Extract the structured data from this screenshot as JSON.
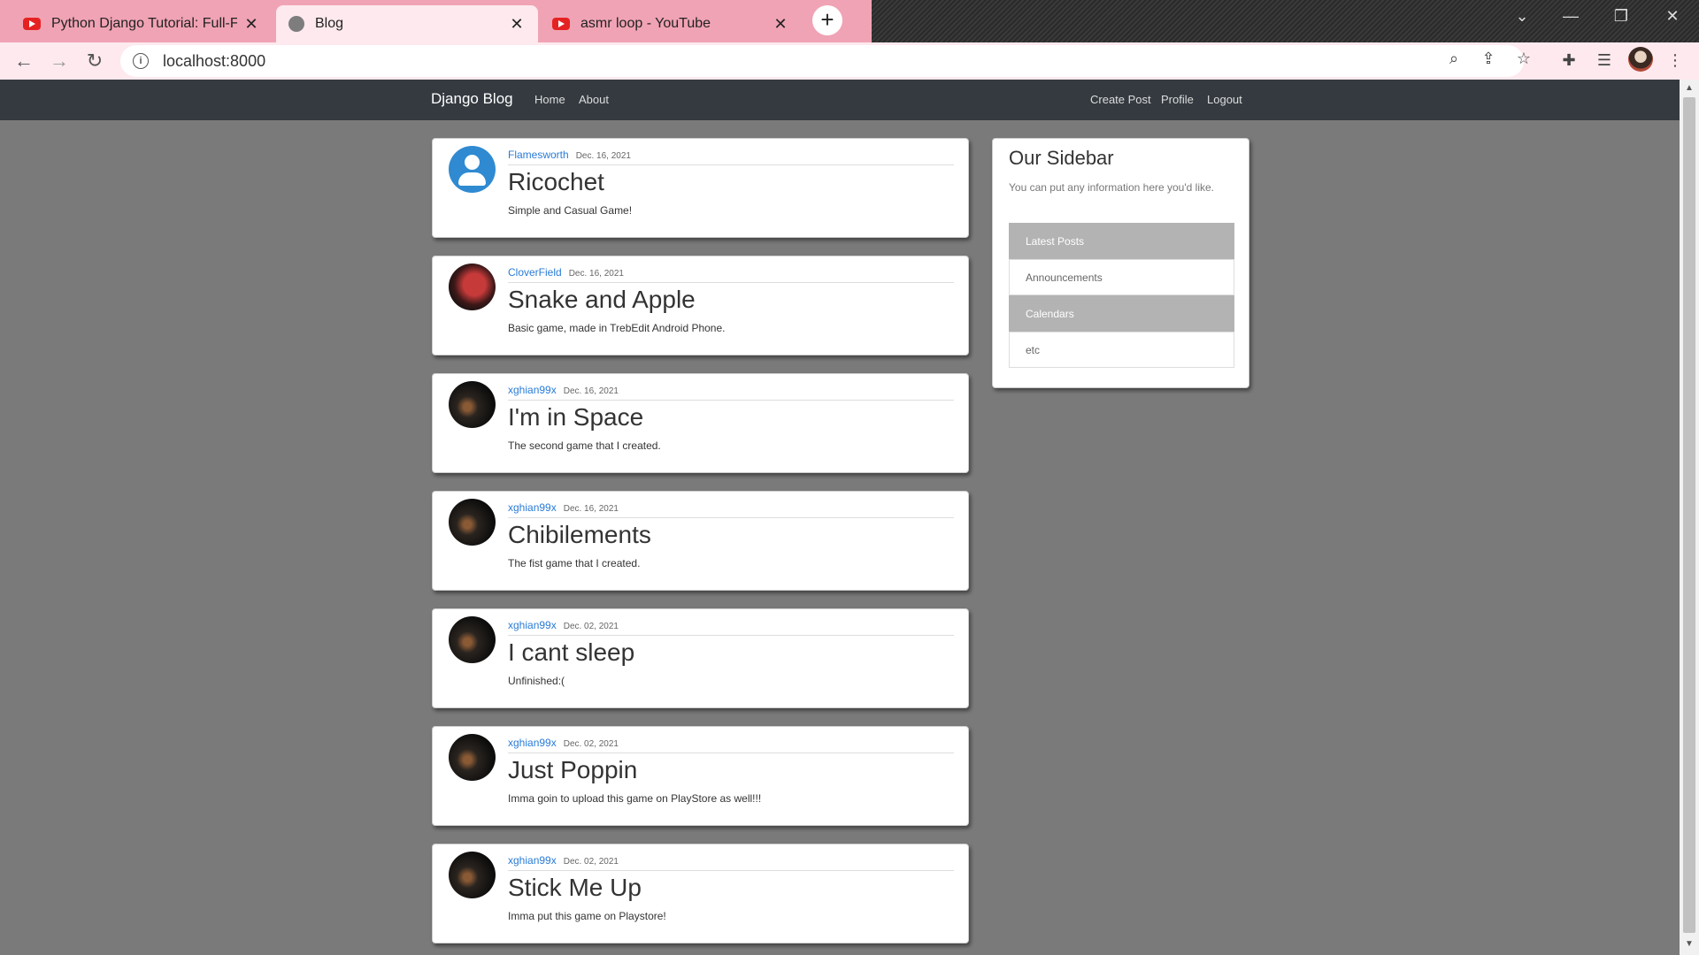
{
  "browser": {
    "tabs": [
      {
        "label": "Python Django Tutorial: Full-Feat",
        "favicon": "youtube-icon"
      },
      {
        "label": "Blog",
        "favicon": "globe-icon"
      },
      {
        "label": "asmr loop - YouTube",
        "favicon": "youtube-icon"
      }
    ],
    "active_tab_index": 1,
    "url": "localhost:8000",
    "colors": {
      "tabbar": "#f0a3b4",
      "toolbar": "#fde9ee"
    }
  },
  "site": {
    "brand": "Django Blog",
    "nav_left": [
      "Home",
      "About"
    ],
    "nav_right": [
      "Create Post",
      "Profile",
      "Logout"
    ]
  },
  "posts": [
    {
      "author": "Flamesworth",
      "date": "Dec. 16, 2021",
      "title": "Ricochet",
      "content": "Simple and Casual Game!",
      "avatar": "default-user-avatar"
    },
    {
      "author": "CloverField",
      "date": "Dec. 16, 2021",
      "title": "Snake and Apple",
      "content": "Basic game, made in TrebEdit Android Phone.",
      "avatar": "spiderman-avatar"
    },
    {
      "author": "xghian99x",
      "date": "Dec. 16, 2021",
      "title": "I'm in Space",
      "content": "The second game that I created.",
      "avatar": "dark-avatar"
    },
    {
      "author": "xghian99x",
      "date": "Dec. 16, 2021",
      "title": "Chibilements",
      "content": "The fist game that I created.",
      "avatar": "dark-avatar"
    },
    {
      "author": "xghian99x",
      "date": "Dec. 02, 2021",
      "title": "I cant sleep",
      "content": "Unfinished:(",
      "avatar": "dark-avatar"
    },
    {
      "author": "xghian99x",
      "date": "Dec. 02, 2021",
      "title": "Just Poppin",
      "content": "Imma goin to upload this game on PlayStore as well!!!",
      "avatar": "dark-avatar"
    },
    {
      "author": "xghian99x",
      "date": "Dec. 02, 2021",
      "title": "Stick Me Up",
      "content": "Imma put this game on Playstore!",
      "avatar": "dark-avatar"
    }
  ],
  "sidebar": {
    "title": "Our Sidebar",
    "text": "You can put any information here you'd like.",
    "items": [
      "Latest Posts",
      "Announcements",
      "Calendars",
      "etc"
    ]
  }
}
